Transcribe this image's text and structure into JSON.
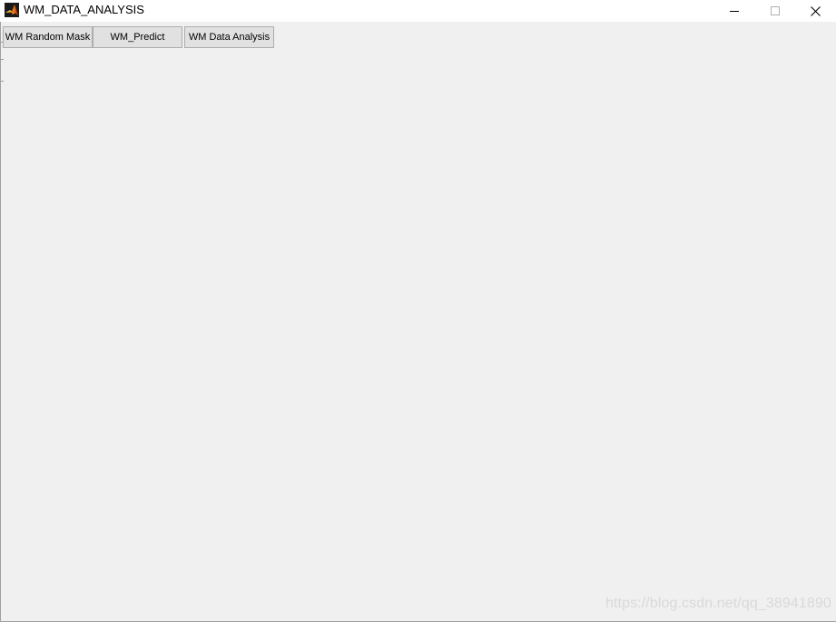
{
  "window": {
    "title": "WM_DATA_ANALYSIS",
    "controls": {
      "minimize": "minimize-icon",
      "maximize": "maximize-icon",
      "close": "close-icon"
    }
  },
  "toolbar": {
    "buttons": [
      {
        "label": "WM Random Mask"
      },
      {
        "label": "WM_Predict"
      },
      {
        "label": "WM Data Analysis"
      }
    ]
  },
  "watermark": {
    "text": "https://blog.csdn.net/qq_38941890"
  },
  "colors": {
    "background": "#f0f0f0",
    "titlebar": "#ffffff",
    "button": "#e1e1e1",
    "button_border": "#adadad"
  }
}
